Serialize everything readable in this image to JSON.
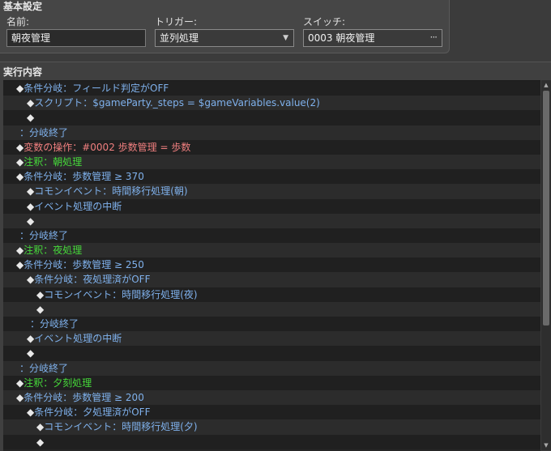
{
  "basic": {
    "title": "基本設定",
    "name_label": "名前:",
    "name_value": "朝夜管理",
    "trigger_label": "トリガー:",
    "trigger_value": "並列処理",
    "switch_label": "スイッチ:",
    "switch_value": "0003 朝夜管理"
  },
  "exec": {
    "title": "実行内容",
    "rows": [
      {
        "indent": 1,
        "dia": true,
        "text": "条件分岐：フィールド判定がOFF",
        "color": "blue"
      },
      {
        "indent": 2,
        "dia": true,
        "text": "スクリプト：$gameParty._steps = $gameVariables.value(2)",
        "color": "blue_script"
      },
      {
        "indent": 2,
        "dia": true,
        "text": "",
        "color": "white"
      },
      {
        "indent": 1,
        "dia": false,
        "text": "：分岐終了",
        "color": "blue"
      },
      {
        "indent": 1,
        "dia": true,
        "text": "変数の操作：#0002 歩数管理 = 歩数",
        "color": "red"
      },
      {
        "indent": 1,
        "dia": true,
        "text": "注釈：朝処理",
        "color": "green"
      },
      {
        "indent": 1,
        "dia": true,
        "text": "条件分岐：歩数管理 ≥ 370",
        "color": "blue"
      },
      {
        "indent": 2,
        "dia": true,
        "text": "コモンイベント：時間移行処理(朝)",
        "color": "blue"
      },
      {
        "indent": 2,
        "dia": true,
        "text": "イベント処理の中断",
        "color": "blue"
      },
      {
        "indent": 2,
        "dia": true,
        "text": "",
        "color": "white"
      },
      {
        "indent": 1,
        "dia": false,
        "text": "：分岐終了",
        "color": "blue"
      },
      {
        "indent": 1,
        "dia": true,
        "text": "注釈：夜処理",
        "color": "green"
      },
      {
        "indent": 1,
        "dia": true,
        "text": "条件分岐：歩数管理 ≥ 250",
        "color": "blue"
      },
      {
        "indent": 2,
        "dia": true,
        "text": "条件分岐：夜処理済がOFF",
        "color": "blue"
      },
      {
        "indent": 3,
        "dia": true,
        "text": "コモンイベント：時間移行処理(夜)",
        "color": "blue"
      },
      {
        "indent": 3,
        "dia": true,
        "text": "",
        "color": "white"
      },
      {
        "indent": 2,
        "dia": false,
        "text": "：分岐終了",
        "color": "blue"
      },
      {
        "indent": 2,
        "dia": true,
        "text": "イベント処理の中断",
        "color": "blue"
      },
      {
        "indent": 2,
        "dia": true,
        "text": "",
        "color": "white"
      },
      {
        "indent": 1,
        "dia": false,
        "text": "：分岐終了",
        "color": "blue"
      },
      {
        "indent": 1,
        "dia": true,
        "text": "注釈：夕刻処理",
        "color": "green"
      },
      {
        "indent": 1,
        "dia": true,
        "text": "条件分岐：歩数管理 ≥ 200",
        "color": "blue"
      },
      {
        "indent": 2,
        "dia": true,
        "text": "条件分岐：夕処理済がOFF",
        "color": "blue"
      },
      {
        "indent": 3,
        "dia": true,
        "text": "コモンイベント：時間移行処理(夕)",
        "color": "blue"
      },
      {
        "indent": 3,
        "dia": true,
        "text": "",
        "color": "white"
      }
    ]
  },
  "icons": {
    "bullet": "diamond-icon",
    "dropdown": "chevron-down-icon",
    "picker": "ellipsis-icon"
  }
}
